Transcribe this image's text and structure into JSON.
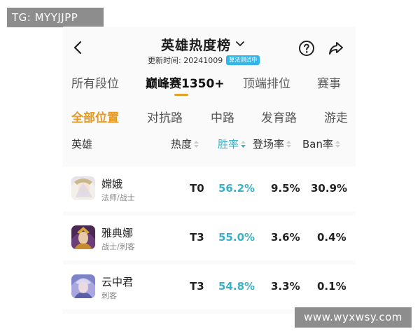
{
  "watermarks": {
    "top_left": "TG: MYYJJPP",
    "bottom_right": "www.wyxwsy.com"
  },
  "header": {
    "title": "英雄热度榜",
    "update_label": "更新时间: 20241009",
    "badge": "算法测试中",
    "icons": [
      "back-icon",
      "chevron-down-icon",
      "help-icon",
      "share-icon"
    ]
  },
  "tabs": [
    {
      "label": "所有段位",
      "active": false
    },
    {
      "label": "巅峰赛1350+",
      "active": true
    },
    {
      "label": "顶端排位",
      "active": false
    },
    {
      "label": "赛事",
      "active": false
    }
  ],
  "positions": [
    {
      "label": "全部位置",
      "active": true
    },
    {
      "label": "对抗路",
      "active": false
    },
    {
      "label": "中路",
      "active": false
    },
    {
      "label": "发育路",
      "active": false
    },
    {
      "label": "游走",
      "active": false
    }
  ],
  "columns": {
    "hero": "英雄",
    "heat": "热度",
    "win_rate": "胜率",
    "pick_rate": "登场率",
    "ban_rate": "Ban率"
  },
  "rows": [
    {
      "name": "嫦娥",
      "role": "法师/战士",
      "heat": "T0",
      "win_rate": "56.2%",
      "pick_rate": "9.5%",
      "ban_rate": "30.9%"
    },
    {
      "name": "雅典娜",
      "role": "战士/刺客",
      "heat": "T3",
      "win_rate": "55.0%",
      "pick_rate": "3.6%",
      "ban_rate": "0.4%"
    },
    {
      "name": "云中君",
      "role": "刺客",
      "heat": "T3",
      "win_rate": "54.8%",
      "pick_rate": "3.3%",
      "ban_rate": "0.1%"
    }
  ],
  "colors": {
    "accent": "#e59a23",
    "win_rate": "#3ab0c8",
    "badge": "#34b7e8"
  }
}
